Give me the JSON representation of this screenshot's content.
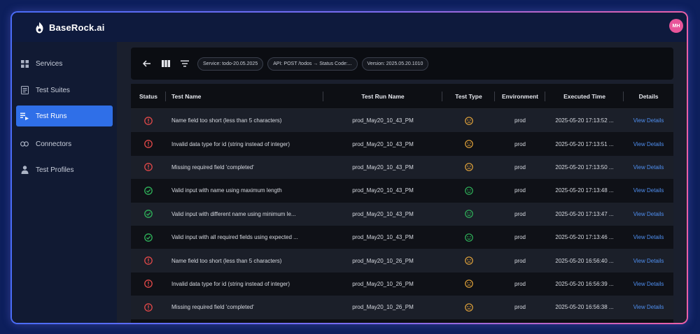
{
  "app": {
    "logo_text": "BaseRock.ai",
    "avatar_initials": "MH"
  },
  "colors": {
    "accent": "#2f6fe8",
    "fail": "#e04848",
    "pass": "#2fb35a",
    "neutral": "#e2a33a",
    "link": "#4f8ff0"
  },
  "sidebar": {
    "items": [
      {
        "label": "Services",
        "icon": "grid-icon",
        "active": false
      },
      {
        "label": "Test Suites",
        "icon": "document-icon",
        "active": false
      },
      {
        "label": "Test Runs",
        "icon": "list-play-icon",
        "active": true
      },
      {
        "label": "Connectors",
        "icon": "link-icon",
        "active": false
      },
      {
        "label": "Test Profiles",
        "icon": "person-icon",
        "active": false
      }
    ]
  },
  "filters": {
    "chips": [
      "Service: todo-20.05.2025",
      "API: POST /todos → Status Code:...",
      "Version: 2025.05.20.1010"
    ]
  },
  "table": {
    "headers": [
      "Status",
      "Test Name",
      "Test Run Name",
      "Test Type",
      "Environment",
      "Executed Time",
      "Details"
    ],
    "rows": [
      {
        "status": "fail",
        "name": "Name field too short (less than 5 characters)",
        "run": "prod_May20_10_43_PM",
        "type": "neutral",
        "env": "prod",
        "time": "2025-05-20 17:13:52 ...",
        "details": "View Details"
      },
      {
        "status": "fail",
        "name": "Invalid data type for id (string instead of integer)",
        "run": "prod_May20_10_43_PM",
        "type": "neutral",
        "env": "prod",
        "time": "2025-05-20 17:13:51 ...",
        "details": "View Details"
      },
      {
        "status": "fail",
        "name": "Missing required field 'completed'",
        "run": "prod_May20_10_43_PM",
        "type": "neutral",
        "env": "prod",
        "time": "2025-05-20 17:13:50 ...",
        "details": "View Details"
      },
      {
        "status": "pass",
        "name": "Valid input with name using maximum length",
        "run": "prod_May20_10_43_PM",
        "type": "positive",
        "env": "prod",
        "time": "2025-05-20 17:13:48 ...",
        "details": "View Details"
      },
      {
        "status": "pass",
        "name": "Valid input with different name using minimum le...",
        "run": "prod_May20_10_43_PM",
        "type": "positive",
        "env": "prod",
        "time": "2025-05-20 17:13:47 ...",
        "details": "View Details"
      },
      {
        "status": "pass",
        "name": "Valid input with all required fields using expected ...",
        "run": "prod_May20_10_43_PM",
        "type": "positive",
        "env": "prod",
        "time": "2025-05-20 17:13:46 ...",
        "details": "View Details"
      },
      {
        "status": "fail",
        "name": "Name field too short (less than 5 characters)",
        "run": "prod_May20_10_26_PM",
        "type": "neutral",
        "env": "prod",
        "time": "2025-05-20 16:56:40 ...",
        "details": "View Details"
      },
      {
        "status": "fail",
        "name": "Invalid data type for id (string instead of integer)",
        "run": "prod_May20_10_26_PM",
        "type": "neutral",
        "env": "prod",
        "time": "2025-05-20 16:56:39 ...",
        "details": "View Details"
      },
      {
        "status": "fail",
        "name": "Missing required field 'completed'",
        "run": "prod_May20_10_26_PM",
        "type": "neutral",
        "env": "prod",
        "time": "2025-05-20 16:56:38 ...",
        "details": "View Details"
      }
    ]
  }
}
